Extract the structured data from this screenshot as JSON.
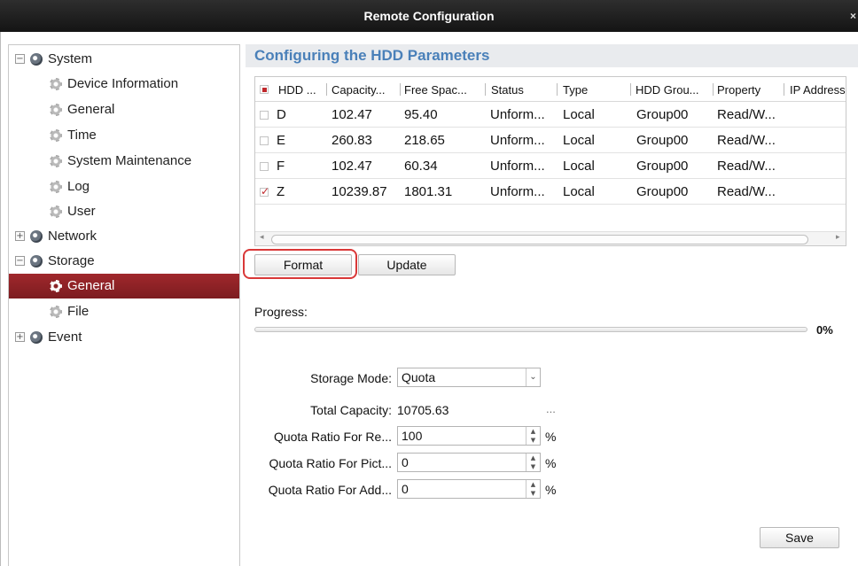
{
  "window": {
    "title": "Remote Configuration",
    "close": "×"
  },
  "sidebar": {
    "items": [
      {
        "label": "System",
        "toggle": "−",
        "icon": "group-icon"
      },
      {
        "label": "Device Information",
        "icon": "gear-icon"
      },
      {
        "label": "General",
        "icon": "gear-icon"
      },
      {
        "label": "Time",
        "icon": "gear-icon"
      },
      {
        "label": "System Maintenance",
        "icon": "gear-icon"
      },
      {
        "label": "Log",
        "icon": "gear-icon"
      },
      {
        "label": "User",
        "icon": "gear-icon"
      },
      {
        "label": "Network",
        "toggle": "+",
        "icon": "group-icon"
      },
      {
        "label": "Storage",
        "toggle": "−",
        "icon": "group-icon"
      },
      {
        "label": "General",
        "icon": "gear-icon",
        "selected": true
      },
      {
        "label": "File",
        "icon": "gear-icon"
      },
      {
        "label": "Event",
        "toggle": "+",
        "icon": "group-icon"
      }
    ]
  },
  "main": {
    "title": "Configuring the HDD Parameters",
    "table": {
      "headers": [
        "HDD ...",
        "Capacity...",
        "Free Spac...",
        "Status",
        "Type",
        "HDD Grou...",
        "Property",
        "IP Address"
      ],
      "rows": [
        {
          "checked": false,
          "hdd": "D",
          "capacity": "102.47",
          "free": "95.40",
          "status": "Unform...",
          "type": "Local",
          "group": "Group00",
          "property": "Read/W..."
        },
        {
          "checked": false,
          "hdd": "E",
          "capacity": "260.83",
          "free": "218.65",
          "status": "Unform...",
          "type": "Local",
          "group": "Group00",
          "property": "Read/W..."
        },
        {
          "checked": false,
          "hdd": "F",
          "capacity": "102.47",
          "free": "60.34",
          "status": "Unform...",
          "type": "Local",
          "group": "Group00",
          "property": "Read/W..."
        },
        {
          "checked": true,
          "hdd": "Z",
          "capacity": "10239.87",
          "free": "1801.31",
          "status": "Unform...",
          "type": "Local",
          "group": "Group00",
          "property": "Read/W..."
        }
      ]
    },
    "buttons": {
      "format": "Format",
      "update": "Update",
      "save": "Save"
    },
    "progress": {
      "label": "Progress:",
      "value": 0,
      "percent_text": "0%"
    },
    "form": {
      "storage_mode_label": "Storage Mode:",
      "storage_mode_value": "Quota",
      "total_capacity_label": "Total Capacity:",
      "total_capacity_value": "10705.63",
      "total_capacity_more": "...",
      "quota_record_label": "Quota Ratio For Re...",
      "quota_record_value": "100",
      "quota_picture_label": "Quota Ratio For Pict...",
      "quota_picture_value": "0",
      "quota_additional_label": "Quota Ratio For Add...",
      "quota_additional_value": "0",
      "unit": "%"
    }
  }
}
